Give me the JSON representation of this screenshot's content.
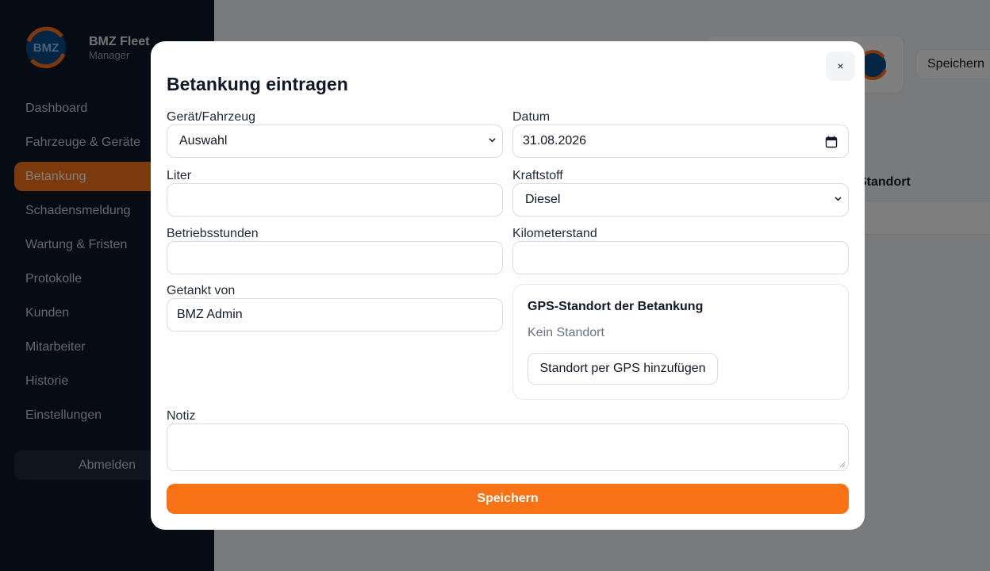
{
  "brand": {
    "name": "BMZ Fleet",
    "subtitle": "Manager",
    "logo_text": "BMZ"
  },
  "sidebar": {
    "items": [
      {
        "label": "Dashboard"
      },
      {
        "label": "Fahrzeuge & Geräte"
      },
      {
        "label": "Betankung",
        "active": true
      },
      {
        "label": "Schadensmeldung"
      },
      {
        "label": "Wartung & Fristen"
      },
      {
        "label": "Protokolle"
      },
      {
        "label": "Kunden"
      },
      {
        "label": "Mitarbeiter"
      },
      {
        "label": "Historie"
      },
      {
        "label": "Einstellungen"
      }
    ],
    "logout_label": "Abmelden"
  },
  "background": {
    "header_save_label": "Speichern",
    "table_col_standort": "Standort"
  },
  "modal": {
    "title": "Betankung eintragen",
    "close_label": "×",
    "fields": {
      "device_label": "Gerät/Fahrzeug",
      "device_value": "Auswahl",
      "date_label": "Datum",
      "date_value": "31.08.2026",
      "liter_label": "Liter",
      "liter_value": "",
      "fuel_label": "Kraftstoff",
      "fuel_value": "Diesel",
      "hours_label": "Betriebsstunden",
      "hours_value": "",
      "km_label": "Kilometerstand",
      "km_value": "",
      "by_label": "Getankt von",
      "by_value": "BMZ Admin",
      "note_label": "Notiz",
      "note_value": ""
    },
    "gps": {
      "title": "GPS-Standort der Betankung",
      "status": "Kein Standort",
      "button_label": "Standort per GPS hinzufügen"
    },
    "save_label": "Speichern"
  },
  "colors": {
    "accent": "#f97316",
    "sidebar_bg": "#0f1729",
    "overlay": "rgba(0,0,0,0.5)"
  },
  "icons": [
    "logo",
    "close-icon",
    "chevron-down-icon",
    "calendar-icon",
    "resize-handle-icon"
  ]
}
